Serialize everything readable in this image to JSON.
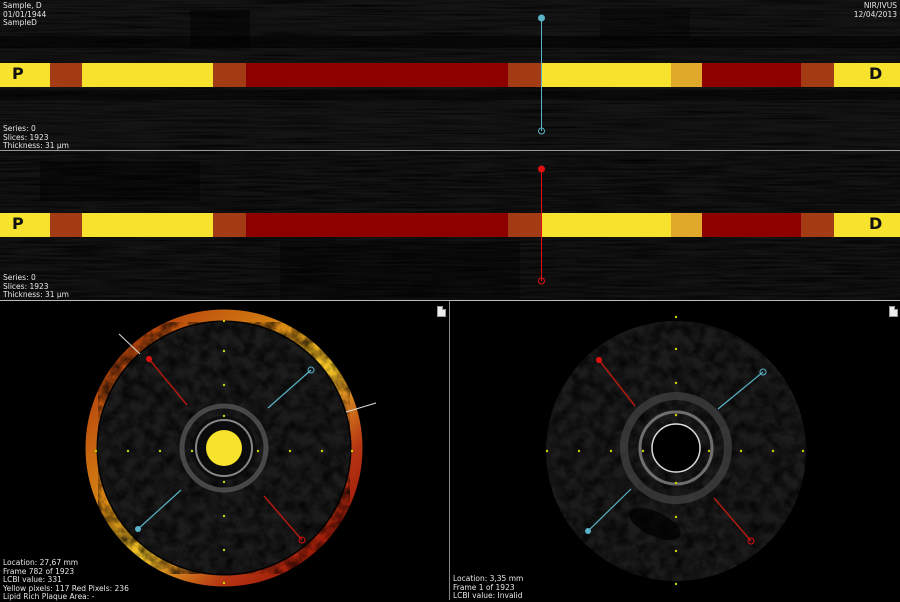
{
  "patient": {
    "name": "Sample, D",
    "dob": "01/01/1944",
    "id": "SampleD"
  },
  "header_right": {
    "modality": "NIR/IVUS",
    "date": "12/04/2013"
  },
  "longitudinal_top": {
    "series": "Series: 0",
    "slices": "Slices: 1923",
    "thickness": "Thickness: 31 µm",
    "left_marker": "P",
    "right_marker": "D"
  },
  "longitudinal_bottom": {
    "series": "Series: 0",
    "slices": "Slices: 1923",
    "thickness": "Thickness: 31 µm",
    "left_marker": "P",
    "right_marker": "D"
  },
  "chemogram_segments": [
    {
      "color": "#f7e22e",
      "from": 0,
      "to": 50
    },
    {
      "color": "#a33b14",
      "from": 50,
      "to": 82
    },
    {
      "color": "#f7e22e",
      "from": 82,
      "to": 213
    },
    {
      "color": "#a33b14",
      "from": 213,
      "to": 246
    },
    {
      "color": "#8c0000",
      "from": 246,
      "to": 508
    },
    {
      "color": "#a33b14",
      "from": 508,
      "to": 541
    },
    {
      "color": "#f7e22e",
      "from": 541,
      "to": 671
    },
    {
      "color": "#e0a92a",
      "from": 671,
      "to": 702
    },
    {
      "color": "#8c0000",
      "from": 702,
      "to": 801
    },
    {
      "color": "#a33b14",
      "from": 801,
      "to": 834
    },
    {
      "color": "#f7e22e",
      "from": 834,
      "to": 900
    }
  ],
  "left_view": {
    "location": "Location: 27,67 mm",
    "frame": "Frame 782 of 1923",
    "lcbi": "LCBI value: 331",
    "pixels": "Yellow pixels: 117 Red Pixels: 236",
    "plaque": "Lipid Rich Plaque Area: -"
  },
  "right_view": {
    "location": "Location: 3,35 mm",
    "frame": "Frame 1 of 1923",
    "lcbi": "LCBI value: Invalid"
  },
  "colors": {
    "yellow": "#f7e22e",
    "dark_red": "#8c0000",
    "rust": "#a33b14",
    "cyan": "#5ab4c8",
    "red_marker": "#e01010"
  }
}
